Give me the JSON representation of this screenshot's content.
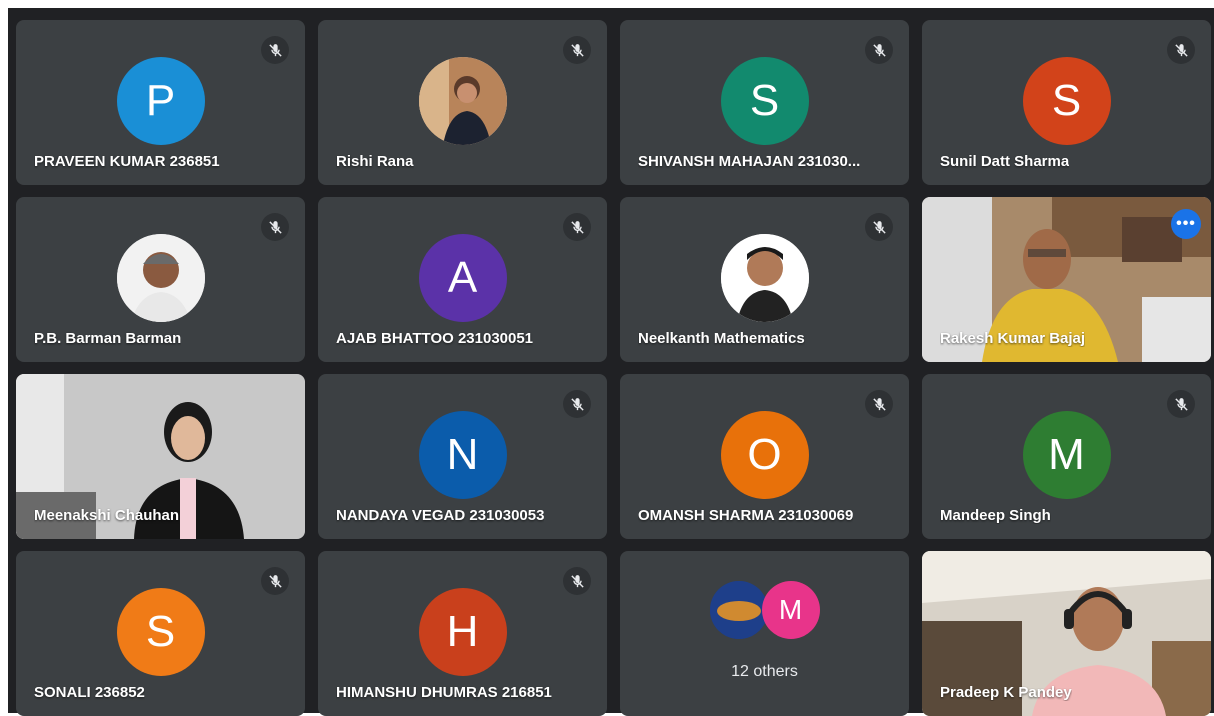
{
  "colors": {
    "background": "#202124",
    "tile": "#3c4043",
    "active_outline": "#8ab4f8",
    "more_button": "#1a73e8"
  },
  "icons": {
    "mute": "mic-off-icon",
    "more": "more-options-icon"
  },
  "tiles": [
    {
      "name": "PRAVEEN KUMAR 236851",
      "initial": "P",
      "color": "#1a8fd6",
      "muted": true
    },
    {
      "name": "Rishi Rana",
      "initial": "",
      "color": "",
      "muted": true
    },
    {
      "name": "SHIVANSH MAHAJAN 231030...",
      "initial": "S",
      "color": "#128a6e",
      "muted": true
    },
    {
      "name": "Sunil Datt Sharma",
      "initial": "S",
      "color": "#d2431a",
      "muted": true
    },
    {
      "name": "P.B. Barman Barman",
      "initial": "",
      "color": "",
      "muted": true
    },
    {
      "name": "AJAB BHATTOO 231030051",
      "initial": "A",
      "color": "#5b32a8",
      "muted": true
    },
    {
      "name": "Neelkanth Mathematics",
      "initial": "",
      "color": "",
      "muted": true
    },
    {
      "name": "Rakesh Kumar Bajaj",
      "initial": "",
      "color": "",
      "muted": false,
      "active": true
    },
    {
      "name": "Meenakshi Chauhan",
      "initial": "",
      "color": "",
      "muted": false
    },
    {
      "name": "NANDAYA VEGAD 231030053",
      "initial": "N",
      "color": "#0b5cab",
      "muted": true
    },
    {
      "name": "OMANSH SHARMA 231030069",
      "initial": "O",
      "color": "#e8710a",
      "muted": true
    },
    {
      "name": "Mandeep Singh",
      "initial": "M",
      "color": "#2e7d32",
      "muted": true
    },
    {
      "name": "SONALI 236852",
      "initial": "S",
      "color": "#f07b17",
      "muted": true
    },
    {
      "name": "HIMANSHU DHUMRAS 216851",
      "initial": "H",
      "color": "#c9401c",
      "muted": true
    },
    {
      "name": "",
      "initial": "",
      "color": "",
      "muted": false
    },
    {
      "name": "Pradeep K Pandey",
      "initial": "",
      "color": "",
      "muted": false
    }
  ],
  "others": {
    "label": "12 others",
    "mini_avatars": [
      {
        "initial": "",
        "color": "#1e3f8a"
      },
      {
        "initial": "M",
        "color": "#e8348a"
      }
    ]
  }
}
